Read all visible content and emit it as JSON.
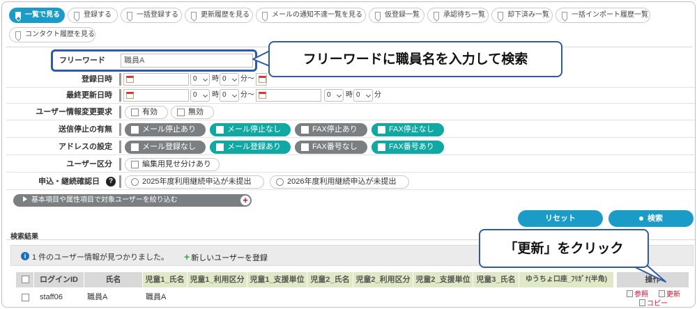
{
  "tabs": [
    {
      "label": "一覧で見る",
      "active": true
    },
    {
      "label": "登録する"
    },
    {
      "label": "一括登録する"
    },
    {
      "label": "更新履歴を見る"
    },
    {
      "label": "メールの通知不達一覧を見る"
    },
    {
      "label": "仮登録一覧"
    },
    {
      "label": "承認待ち一覧"
    },
    {
      "label": "却下済み一覧"
    },
    {
      "label": "一括インポート履歴一覧"
    },
    {
      "label": "コンタクト履歴を見る"
    }
  ],
  "form": {
    "freeword_label": "フリーワード",
    "freeword_value": "職員A",
    "registered_label": "登録日時",
    "updated_label": "最終更新日時",
    "hour_value": "0",
    "minute_value": "0",
    "hour_unit": "時",
    "minute_unit": "分",
    "range_sep": "分〜",
    "change_request_label": "ユーザー情報変更要求",
    "change_request_options": [
      "有効",
      "無効"
    ],
    "stop_label": "送信停止の有無",
    "stop_options": [
      "メール停止あり",
      "メール停止なし",
      "FAX停止あり",
      "FAX停止なし"
    ],
    "address_label": "アドレスの設定",
    "address_options": [
      "メール登録なし",
      "メール登録あり",
      "FAX番号なし",
      "FAX番号あり"
    ],
    "user_type_label": "ユーザー区分",
    "user_type_option": "編集用見せ分けあり",
    "confirm_label": "申込・継続確認日",
    "help_glyph": "?",
    "confirm_options": [
      "2025年度利用継続申込が未提出",
      "2026年度利用継続申込が未提出"
    ],
    "filter_bar_label": "基本項目や属性項目で対象ユーザーを絞り込む",
    "filter_plus": "+"
  },
  "buttons": {
    "reset": "リセット",
    "search": "検索"
  },
  "results": {
    "title": "検索結果",
    "info_glyph": "i",
    "info_text": "1 件のユーザー情報が見つかりました。",
    "add_user_plus": "+",
    "add_user": "新しいユーザーを登録",
    "headers": [
      "ログインID",
      "氏名",
      "児童1_氏名",
      "児童1_利用区分",
      "児童1_支援単位",
      "児童2_氏名",
      "児童2_利用区分",
      "児童2_支援単位",
      "児童3_氏名",
      "ゆうちょ口座_ﾌﾘｶﾞﾅ(半角)",
      "操作"
    ],
    "row": {
      "login_id": "staff06",
      "name": "職員A",
      "child1_name": "職員A"
    },
    "ops": {
      "view": "参照",
      "update": "更新",
      "copy": "コピー"
    }
  },
  "callouts": {
    "freeword": "フリーワードに職員名を入力して検索",
    "update": "「更新」をクリック"
  }
}
